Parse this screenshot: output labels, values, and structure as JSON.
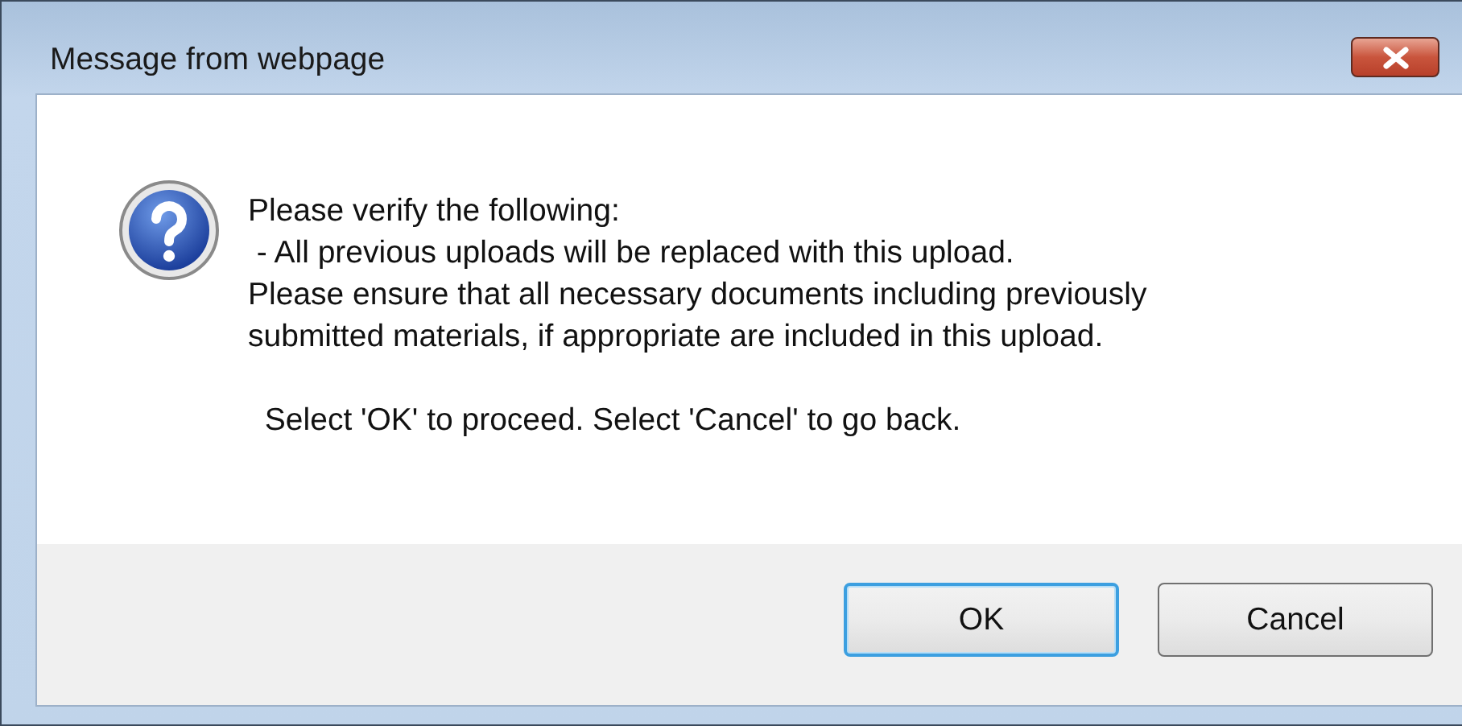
{
  "window": {
    "title": "Message from webpage"
  },
  "message": {
    "lines": [
      "Please verify the following:",
      " - All previous uploads will be replaced with this upload.",
      "Please ensure that all necessary documents including previously",
      "submitted materials, if appropriate are included in this upload."
    ],
    "note": " Select 'OK' to proceed. Select 'Cancel' to go back."
  },
  "buttons": [
    {
      "label": "OK",
      "focused": true
    },
    {
      "label": "Cancel",
      "focused": false
    }
  ]
}
